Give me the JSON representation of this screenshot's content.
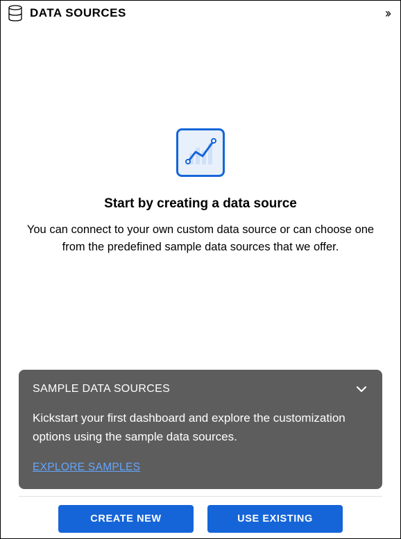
{
  "header": {
    "title": "DATA SOURCES"
  },
  "hero": {
    "title": "Start by creating a data source",
    "description": "You can connect to your own custom data source or can choose one from the predefined sample data sources that we offer."
  },
  "sample_card": {
    "title": "SAMPLE DATA SOURCES",
    "description": "Kickstart your first dashboard and explore the customization options using the sample data sources.",
    "link_label": "EXPLORE SAMPLES"
  },
  "footer": {
    "create_label": "CREATE NEW",
    "existing_label": "USE EXISTING"
  }
}
